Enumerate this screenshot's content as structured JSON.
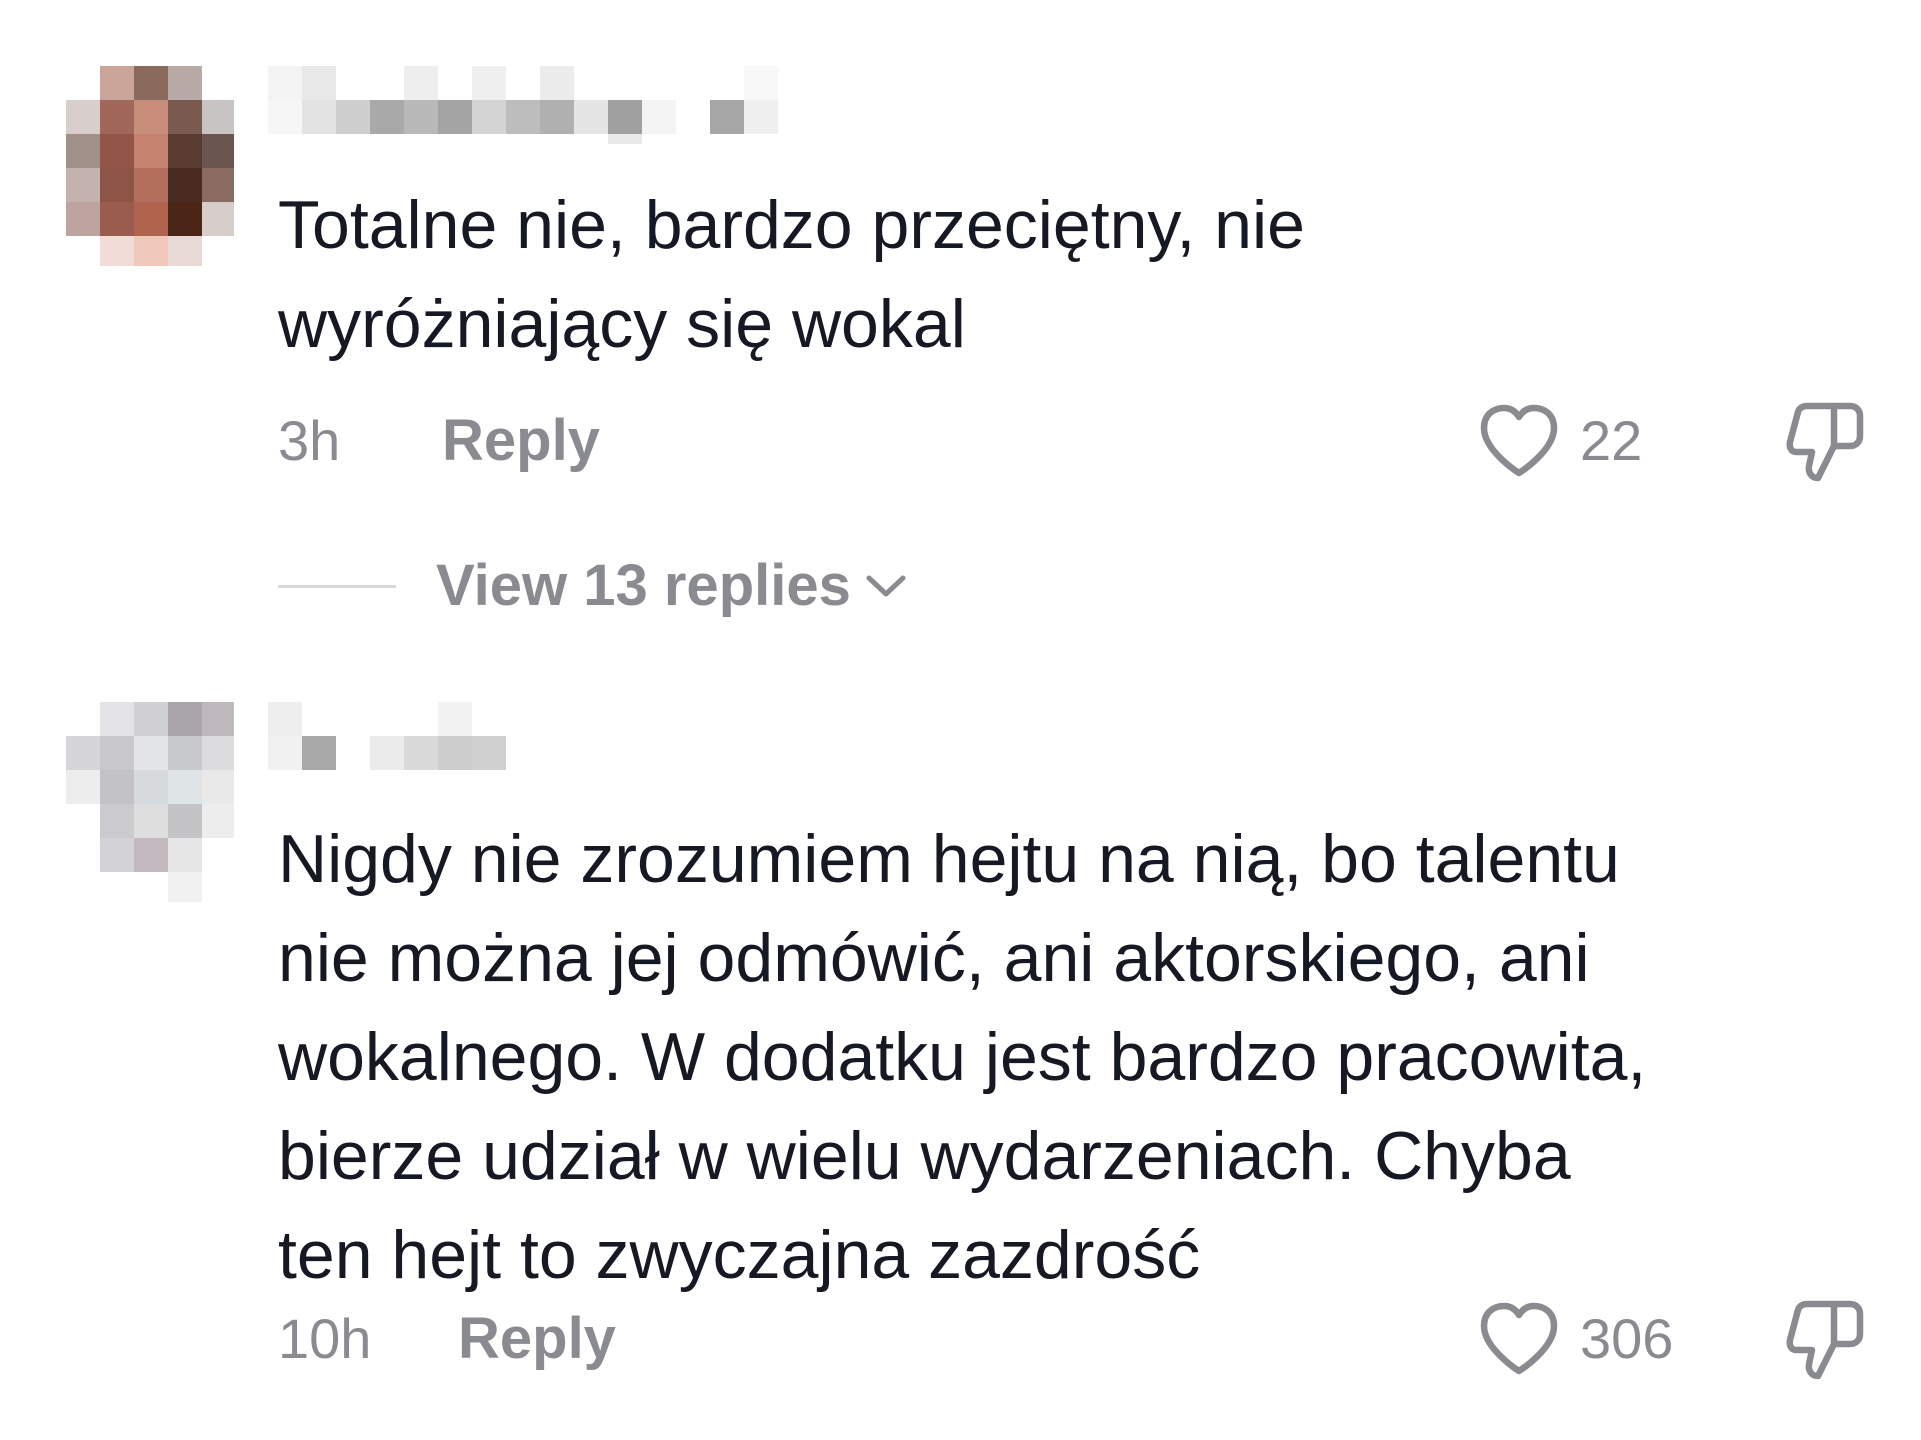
{
  "comments": [
    {
      "text": "Totalne nie, bardzo przeciętny, nie\nwyróżniający się wokal",
      "time": "3h",
      "reply_label": "Reply",
      "likes": "22",
      "view_replies": "View 13 replies"
    },
    {
      "text": "Nigdy nie zrozumiem hejtu na nią, bo talentu\nnie można jej odmówić, ani aktorskiego, ani\nwokalnego. W dodatku jest bardzo pracowita,\nbierze udział w wielu wydarzeniach. Chyba\nten hejt to zwyczajna zazdrość",
      "time": "10h",
      "reply_label": "Reply",
      "likes": "306"
    }
  ],
  "icons": {
    "like": "heart-outline-icon",
    "dislike": "thumbs-down-outline-icon",
    "expand": "chevron-down-icon"
  },
  "colors": {
    "text": "#161823",
    "secondary": "#8a8b91",
    "divider": "#d9d9dc"
  }
}
